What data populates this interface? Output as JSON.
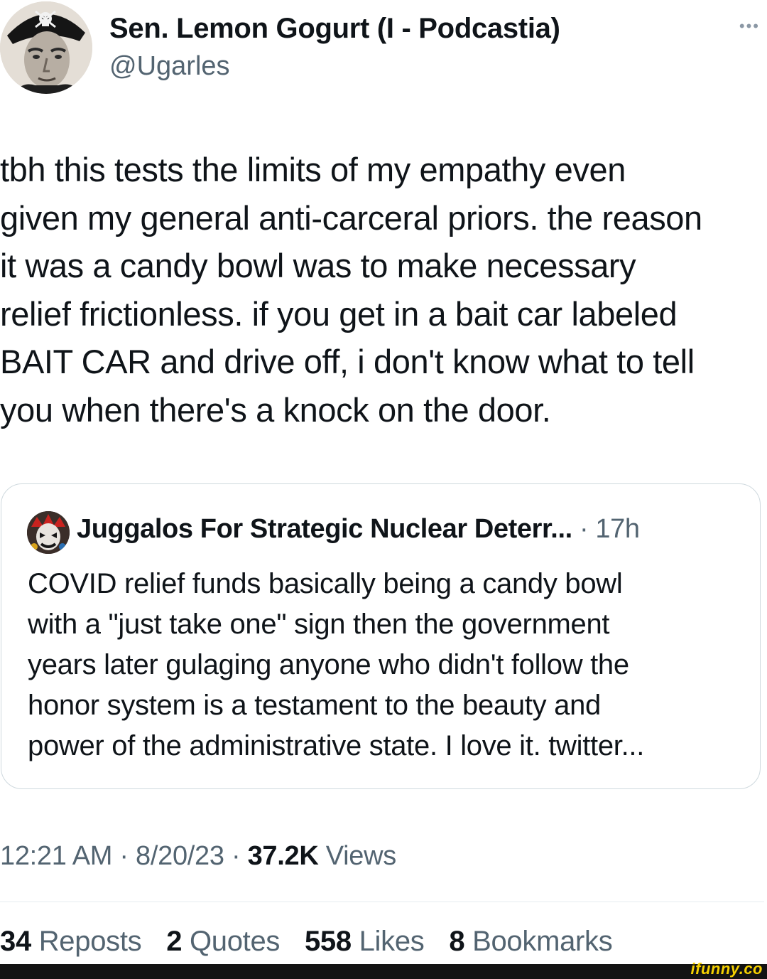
{
  "author": {
    "display_name": "Sen. Lemon Gogurt (I - Podcastia)",
    "handle": "@Ugarles",
    "avatar_icon": "profile-photo-with-skull-pirate-hat"
  },
  "more_icon": "ellipsis-icon",
  "more_glyph": "•••",
  "tweet_text": "tbh this tests the limits of my empathy even\ngiven my general anti-carceral priors. the reason\nit was a candy bowl was to make necessary\nrelief frictionless. if you get in a bait car labeled\nBAIT CAR and drive off, i don't know what to tell\nyou when there's a knock on the door.",
  "quote": {
    "display_name": "Juggalos For Strategic Nuclear Deterr...",
    "separator": " · ",
    "time": "17h",
    "avatar_icon": "juggalo-clown-avatar",
    "text": "COVID relief funds basically being a candy bowl\nwith a \"just take one\" sign then the government\nyears later gulaging anyone who didn't follow the\nhonor system is a testament to the beauty and\npower of the administrative state. I love it. twitter..."
  },
  "meta": {
    "time": "12:21 AM",
    "sep1": " · ",
    "date": "8/20/23",
    "sep2": " · ",
    "views_count": "37.2K",
    "views_label": " Views"
  },
  "stats": [
    {
      "num": "34",
      "label": " Reposts"
    },
    {
      "num": "2",
      "label": " Quotes"
    },
    {
      "num": "558",
      "label": " Likes"
    },
    {
      "num": "8",
      "label": " Bookmarks"
    }
  ],
  "watermark": "ifunny.co",
  "colors": {
    "text": "#0f1419",
    "secondary": "#536471",
    "border": "#cfd9de",
    "watermark": "#f5d000"
  }
}
